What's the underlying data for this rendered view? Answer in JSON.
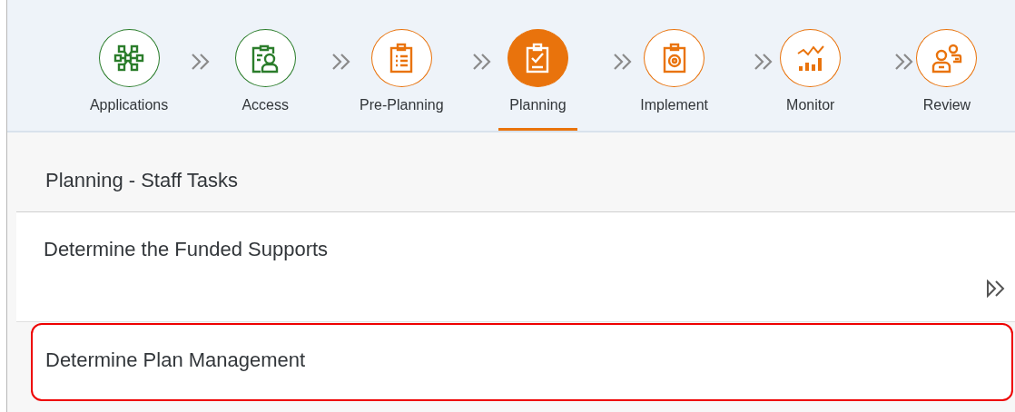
{
  "steps": [
    {
      "label": "Applications",
      "kind": "done",
      "selected": false
    },
    {
      "label": "Access",
      "kind": "done",
      "selected": false
    },
    {
      "label": "Pre-Planning",
      "kind": "pending",
      "selected": false
    },
    {
      "label": "Planning",
      "kind": "current",
      "selected": true
    },
    {
      "label": "Implement",
      "kind": "pending",
      "selected": false
    },
    {
      "label": "Monitor",
      "kind": "pending",
      "selected": false
    },
    {
      "label": "Review",
      "kind": "pending",
      "selected": false
    }
  ],
  "section_title": "Planning - Staff Tasks",
  "tasks": [
    {
      "title": "Determine the Funded Supports",
      "highlighted": false,
      "navigable": true
    },
    {
      "title": "Determine Plan Management",
      "highlighted": true,
      "navigable": false
    }
  ]
}
